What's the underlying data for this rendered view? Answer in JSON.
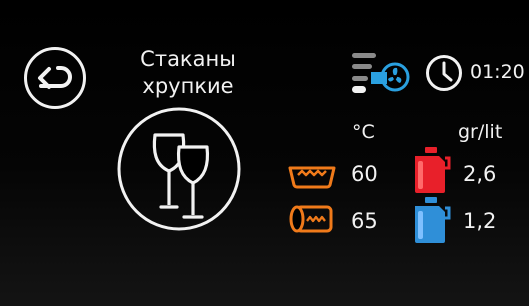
{
  "program": {
    "name_line1": "Стаканы",
    "name_line2": "хрупкие",
    "icon": "wine-glasses-icon"
  },
  "status": {
    "time": "01:20",
    "fan_icon": "fan-drying-icon",
    "clock_icon": "clock-icon"
  },
  "units": {
    "temperature": "°C",
    "dosage": "gr/lit"
  },
  "wash": {
    "icon": "wash-heater-icon",
    "temperature": "60"
  },
  "rinse": {
    "icon": "rinse-boiler-icon",
    "temperature": "65"
  },
  "detergent": {
    "icon": "detergent-canister-icon",
    "dose": "2,6",
    "color": "#e8202a"
  },
  "rinse_aid": {
    "icon": "rinse-aid-canister-icon",
    "dose": "1,2",
    "color": "#2f8fd8"
  },
  "colors": {
    "accent_orange": "#f07a1a",
    "fan_blue": "#2aa0e0",
    "background": "#000000",
    "text": "#f2f2f2"
  }
}
